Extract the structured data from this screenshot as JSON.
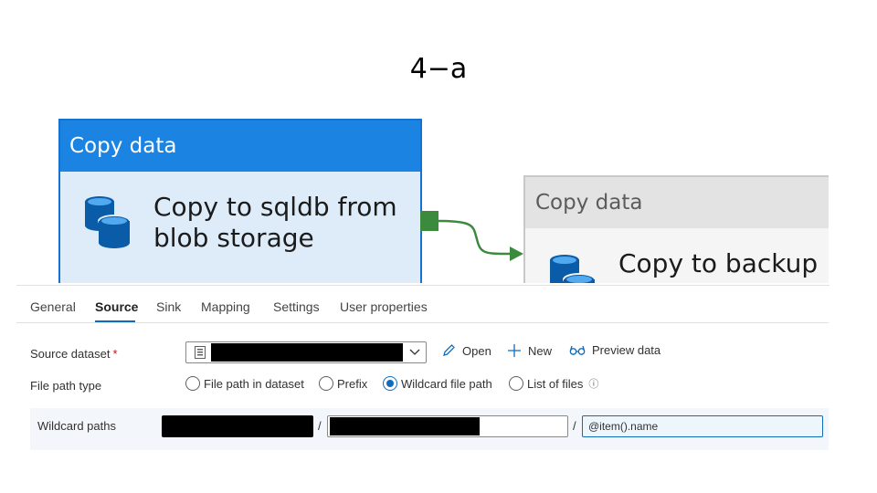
{
  "slide": {
    "title": "4−a"
  },
  "canvas": {
    "activities": [
      {
        "type_label": "Copy data",
        "name_line1": "Copy to sqldb from",
        "name_line2": "blob storage",
        "state": "selected",
        "icon": "database-icon"
      },
      {
        "type_label": "Copy data",
        "name_line1": "Copy to backup",
        "name_line2": "",
        "state": "inactive",
        "icon": "database-icon"
      }
    ],
    "connector": {
      "type": "on-success",
      "color": "#3c8a3e"
    }
  },
  "panel": {
    "tabs": [
      {
        "label": "General",
        "active": false
      },
      {
        "label": "Source",
        "active": true
      },
      {
        "label": "Sink",
        "active": false
      },
      {
        "label": "Mapping",
        "active": false
      },
      {
        "label": "Settings",
        "active": false
      },
      {
        "label": "User properties",
        "active": false
      }
    ],
    "source_dataset": {
      "label": "Source dataset",
      "required_mark": "*",
      "value": "[redacted]",
      "actions": [
        {
          "label": "Open",
          "icon": "pencil-icon"
        },
        {
          "label": "New",
          "icon": "plus-icon"
        },
        {
          "label": "Preview data",
          "icon": "glasses-icon"
        }
      ]
    },
    "file_path_type": {
      "label": "File path type",
      "options": [
        {
          "label": "File path in dataset",
          "checked": false
        },
        {
          "label": "Prefix",
          "checked": false
        },
        {
          "label": "Wildcard file path",
          "checked": true
        },
        {
          "label": "List of files",
          "checked": false,
          "info_icon": "ⓘ"
        }
      ]
    },
    "wildcard_paths": {
      "label": "Wildcard paths",
      "separator": "/",
      "container_value": "[redacted]",
      "folder_value": "[redacted]",
      "file_value": "@item().name"
    },
    "colors": {
      "accent": "#0f6cbd",
      "activity_header": "#1b84e3",
      "activity_body": "#deecf9"
    }
  }
}
